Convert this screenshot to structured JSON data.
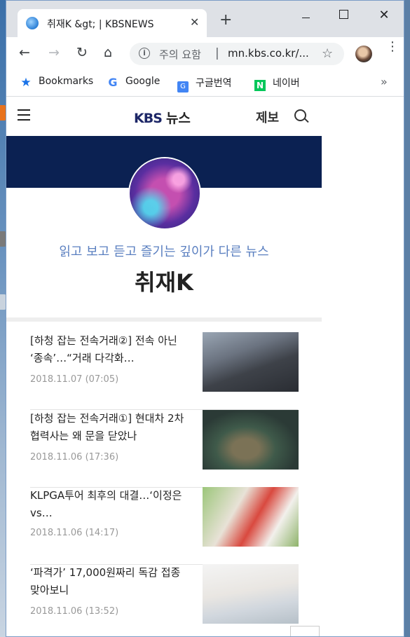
{
  "window": {
    "tab_title": "취재K &gt; | KBSNEWS",
    "tab_close": "✕",
    "new_tab": "+",
    "minimize": "",
    "maximize": "",
    "close": "✕"
  },
  "toolbar": {
    "back": "←",
    "forward": "→",
    "reload": "↻",
    "home": "⌂",
    "security_label": "주의 요함",
    "separator": "|",
    "url": "mn.kbs.co.kr/...",
    "star": "☆",
    "menu": "⋮"
  },
  "bookmarks": {
    "items": [
      {
        "label": "Bookmarks",
        "icon": "star-icon",
        "glyph": "★"
      },
      {
        "label": "Google",
        "icon": "google-icon",
        "glyph": "G"
      },
      {
        "label": "구글번역",
        "icon": "google-translate-icon",
        "glyph": "G"
      },
      {
        "label": "네이버",
        "icon": "naver-icon",
        "glyph": "N"
      }
    ],
    "more": "»"
  },
  "site": {
    "logo_en": "KBS",
    "logo_kr": "뉴스",
    "report": "제보",
    "tagline": "읽고 보고 듣고 즐기는 깊이가 다른 뉴스",
    "section_title": "취재K",
    "brand_color": "#0b2152",
    "accent_color": "#5a7fc0"
  },
  "articles": [
    {
      "title": "[하청 잡는 전속거래②] 전속 아닌 ‘종속’…“거래 다각화…",
      "date": "2018.11.07 (07:05)"
    },
    {
      "title": "[하청 잡는 전속거래①] 현대차 2차 협력사는 왜 문을 닫았나",
      "date": "2018.11.06 (17:36)"
    },
    {
      "title": "KLPGA투어 최후의 대결…‘이정은 vs…",
      "date": "2018.11.06 (14:17)"
    },
    {
      "title": "‘파격가’ 17,000원짜리 독감 접종 맞아보니",
      "date": "2018.11.06 (13:52)"
    }
  ]
}
